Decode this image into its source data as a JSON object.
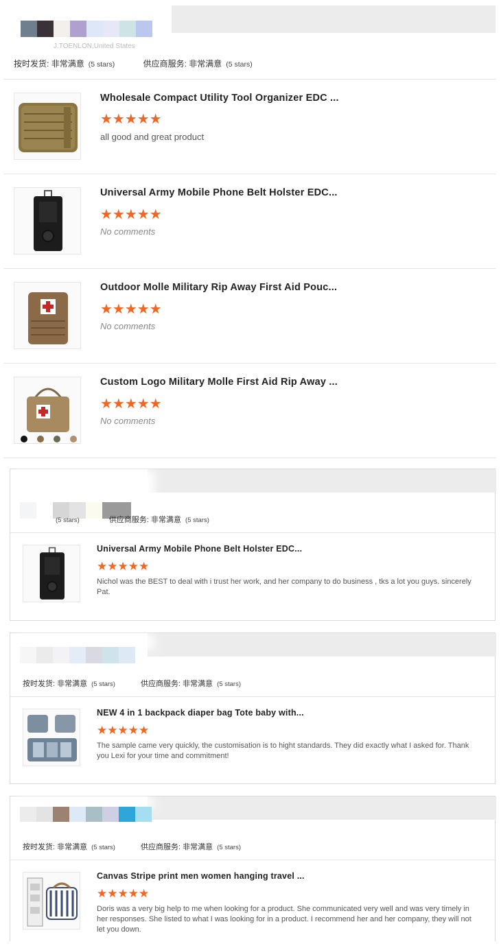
{
  "top_block": {
    "swatches": [
      "#ffffff",
      "#6f7f8e",
      "#3a3236",
      "#f3f0ec",
      "#b0a0cf",
      "#dde7f8",
      "#e6e8f7",
      "#cce4e4",
      "#bcc7f0"
    ],
    "faded_location": "J.TOENLON,United States",
    "ratings": {
      "shipping_label": "按时发货:",
      "shipping_value": "非常满意",
      "shipping_stars": "(5 stars)",
      "supplier_label": "供应商服务:",
      "supplier_value": "非常满意",
      "supplier_stars": "(5 stars)"
    },
    "reviews": [
      {
        "title": "Wholesale Compact Utility Tool Organizer EDC ...",
        "stars": "★★★★★",
        "comment": "all good and great product",
        "no_comment": false,
        "image": "tan-molle-pouch"
      },
      {
        "title": "Universal Army Mobile Phone Belt Holster EDC...",
        "stars": "★★★★★",
        "comment": "No comments",
        "no_comment": true,
        "image": "black-phone-holster"
      },
      {
        "title": "Outdoor Molle Military Rip Away First Aid Pouc...",
        "stars": "★★★★★",
        "comment": "No comments",
        "no_comment": true,
        "image": "first-aid-pouch"
      },
      {
        "title": "Custom Logo Military Molle First Aid Rip Away ...",
        "stars": "★★★★★",
        "comment": "No comments",
        "no_comment": true,
        "image": "first-aid-bag-handles"
      }
    ]
  },
  "cards": [
    {
      "swatches": [
        "#f4f5f7",
        "#ffffff",
        "#d6d6d6",
        "#e3e3e3",
        "#fbfbef",
        "#9a9a9a"
      ],
      "ratings": {
        "shipping_label": "",
        "shipping_value": "",
        "shipping_stars": "(5 stars)",
        "supplier_label": "供应商服务:",
        "supplier_value": "非常满意",
        "supplier_stars": "(5 stars)"
      },
      "review": {
        "title": "Universal Army Mobile Phone Belt Holster EDC...",
        "stars": "★★★★★",
        "comment": "Nichol was the BEST to deal with i trust her work, and her company to do business , tks a lot you guys. sincerely Pat.",
        "image": "black-phone-holster"
      }
    },
    {
      "swatches": [
        "#f6f6f6",
        "#ebebeb",
        "#f3f3f7",
        "#e4ecf7",
        "#d9d9e2",
        "#cfe3ea",
        "#dde9f5"
      ],
      "ratings": {
        "shipping_label": "按时发货:",
        "shipping_value": "非常满意",
        "shipping_stars": "(5 stars)",
        "supplier_label": "供应商服务:",
        "supplier_value": "非常满意",
        "supplier_stars": "(5 stars)"
      },
      "review": {
        "title": "NEW 4 in 1 backpack diaper bag Tote baby with...",
        "stars": "★★★★★",
        "comment": "The sample came very quickly, the customisation is to hight standards. They did exactly what I asked for. Thank you Lexi for your time and commitment!",
        "image": "diaper-bag-set"
      }
    },
    {
      "swatches": [
        "#ececec",
        "#e3e3e3",
        "#9c8270",
        "#dbeaf6",
        "#a8bfc8",
        "#cfcfe4",
        "#2ea6d9",
        "#a6def1"
      ],
      "ratings": {
        "shipping_label": "按时发货:",
        "shipping_value": "非常满意",
        "shipping_stars": "(5 stars)",
        "supplier_label": "供应商服务:",
        "supplier_value": "非常满意",
        "supplier_stars": "(5 stars)"
      },
      "review": {
        "title": "Canvas Stripe print men women hanging travel ...",
        "stars": "★★★★★",
        "comment": "Doris was a very big help to me when looking for a product.  She communicated very well and was very timely in her responses.  She listed to what I was looking for in a product.  I recommend her and her company, they will not let you down.",
        "image": "striped-toiletry-bag"
      }
    }
  ]
}
